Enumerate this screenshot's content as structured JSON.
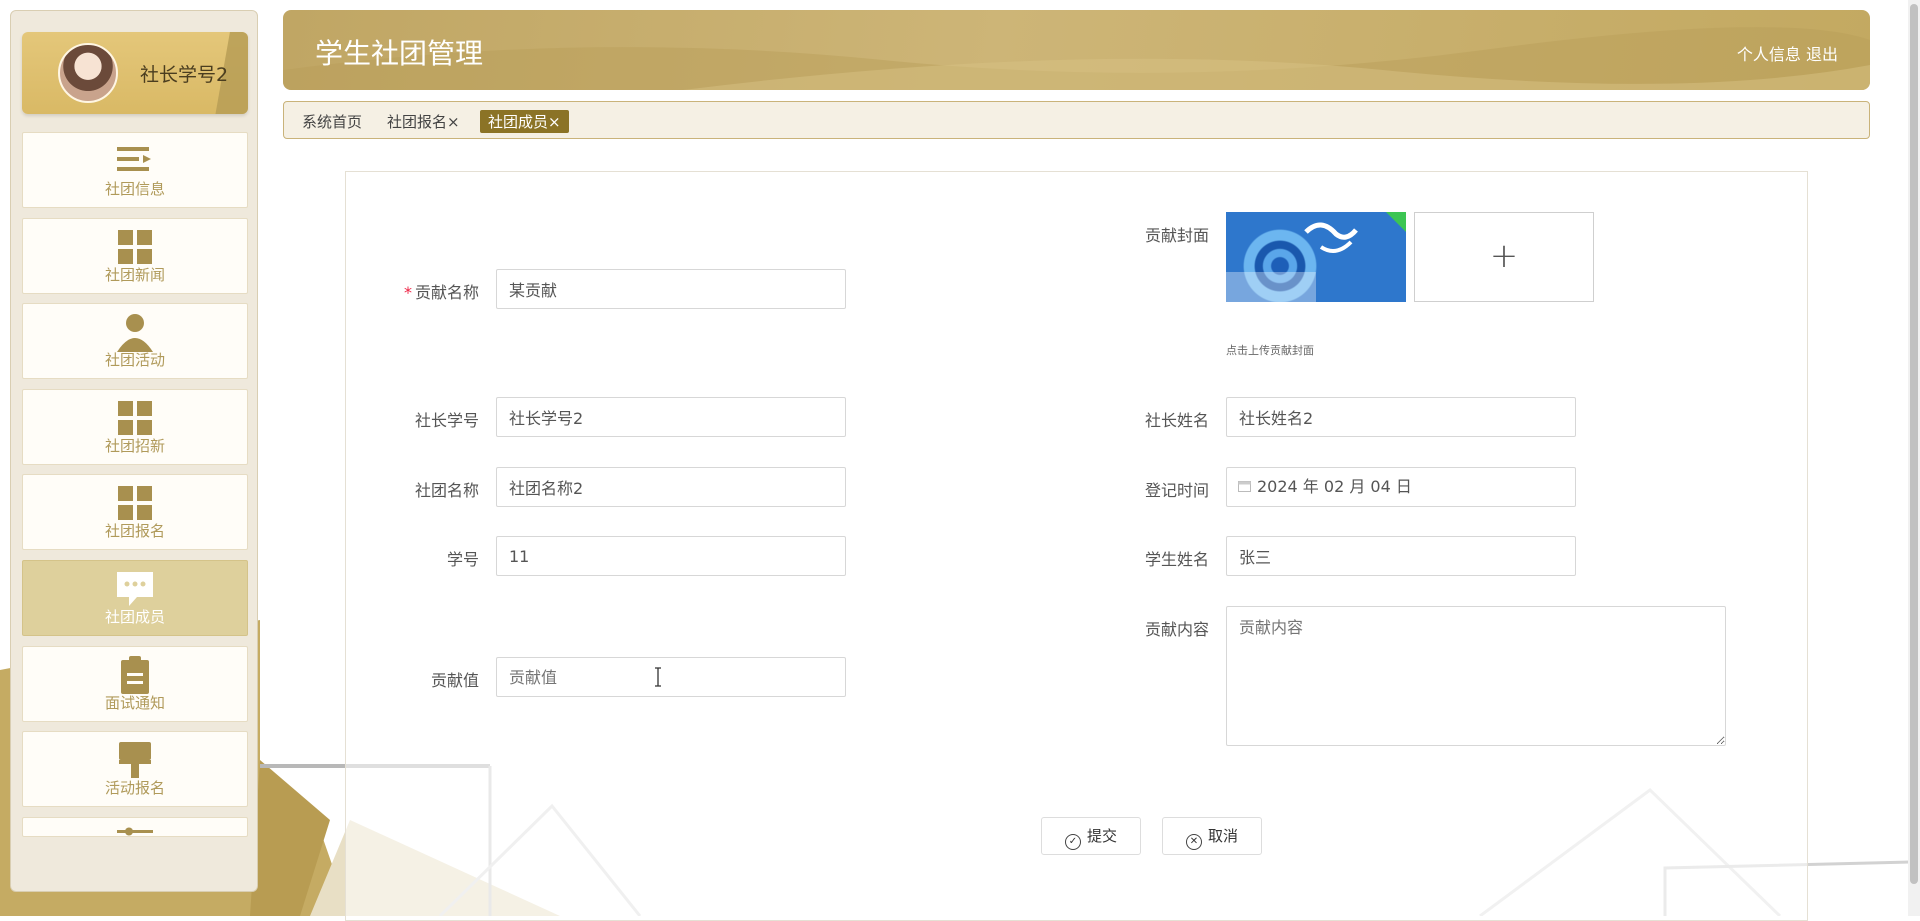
{
  "app": {
    "title": "学生社团管理"
  },
  "header": {
    "profile_label": "个人信息",
    "logout_label": "退出"
  },
  "user": {
    "name": "社长学号2"
  },
  "sidebar": {
    "items": [
      {
        "label": "社团信息",
        "icon": "list-icon"
      },
      {
        "label": "社团新闻",
        "icon": "grid-icon"
      },
      {
        "label": "社团活动",
        "icon": "user-icon"
      },
      {
        "label": "社团招新",
        "icon": "grid-icon"
      },
      {
        "label": "社团报名",
        "icon": "grid-icon"
      },
      {
        "label": "社团成员",
        "icon": "chat-icon",
        "active": true
      },
      {
        "label": "面试通知",
        "icon": "clipboard-icon"
      },
      {
        "label": "活动报名",
        "icon": "brush-icon"
      }
    ]
  },
  "tabs": [
    {
      "label": "系统首页"
    },
    {
      "label": "社团报名",
      "close": "×"
    },
    {
      "label": "社团成员",
      "close": "×",
      "active": true
    }
  ],
  "form": {
    "contribution_name": {
      "label": "贡献名称",
      "required_mark": "*",
      "value": "某贡献"
    },
    "cover": {
      "label": "贡献封面",
      "hint": "点击上传贡献封面",
      "add_symbol": "+"
    },
    "leader_id": {
      "label": "社长学号",
      "value": "社长学号2"
    },
    "leader_name": {
      "label": "社长姓名",
      "value": "社长姓名2"
    },
    "club_name": {
      "label": "社团名称",
      "value": "社团名称2"
    },
    "register_time": {
      "label": "登记时间",
      "value": "2024 年 02 月 04 日"
    },
    "student_id": {
      "label": "学号",
      "value": "11"
    },
    "student_name": {
      "label": "学生姓名",
      "value": "张三"
    },
    "contribution_value": {
      "label": "贡献值",
      "placeholder": "贡献值"
    },
    "contribution_content": {
      "label": "贡献内容",
      "placeholder": "贡献内容"
    }
  },
  "buttons": {
    "submit": "提交",
    "cancel": "取消"
  },
  "colors": {
    "accent": "#c0a664",
    "active_tab": "#8b7326",
    "menu_icon": "#a8904f"
  }
}
